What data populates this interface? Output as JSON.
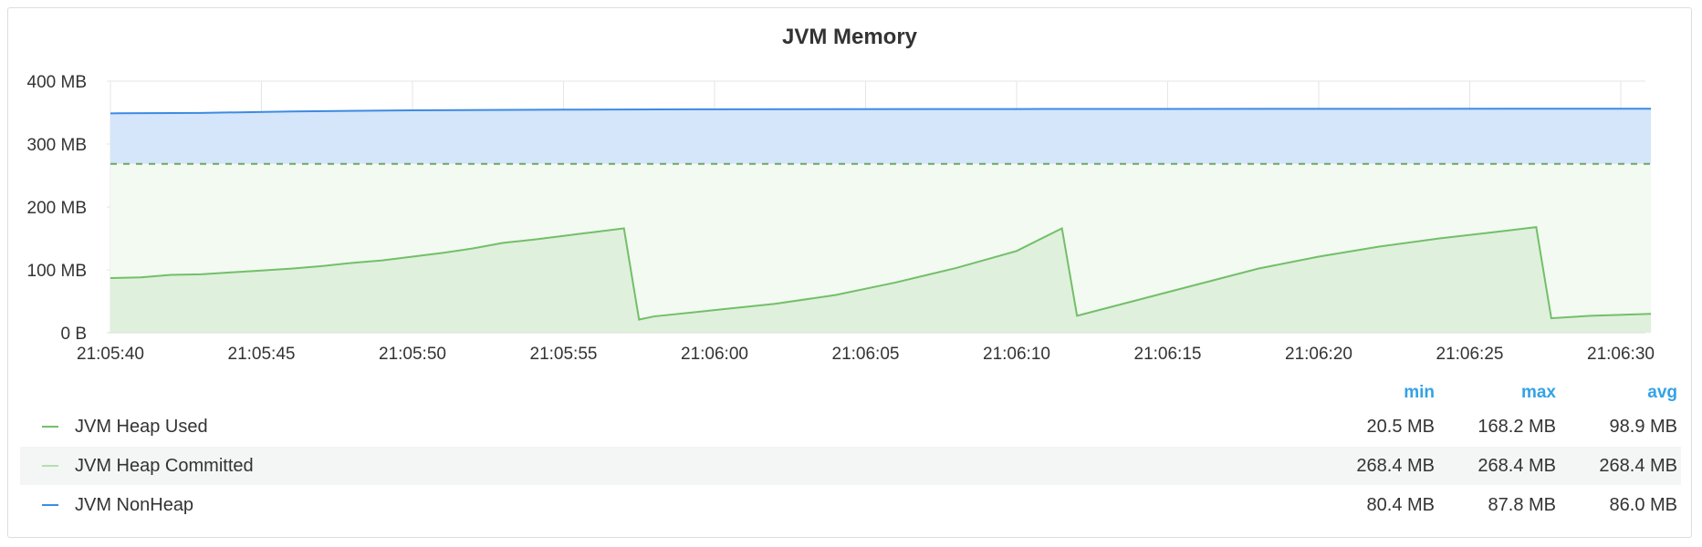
{
  "panel": {
    "title": "JVM Memory"
  },
  "legend": {
    "columns": {
      "min": "min",
      "max": "max",
      "avg": "avg"
    },
    "rows": [
      {
        "name": "JVM Heap Used",
        "color": "#73bf69",
        "min": "20.5 MB",
        "max": "168.2 MB",
        "avg": "98.9 MB"
      },
      {
        "name": "JVM Heap Committed",
        "color": "#b3e0ad",
        "min": "268.4 MB",
        "max": "268.4 MB",
        "avg": "268.4 MB"
      },
      {
        "name": "JVM NonHeap",
        "color": "#3d8be3",
        "min": "80.4 MB",
        "max": "87.8 MB",
        "avg": "86.0 MB"
      }
    ]
  },
  "chart_data": {
    "type": "area",
    "title": "JVM Memory",
    "y_unit": "MB",
    "ylim": [
      0,
      400
    ],
    "yticks": [
      0,
      100,
      200,
      300,
      400
    ],
    "ytick_labels": [
      "0 B",
      "100 MB",
      "200 MB",
      "300 MB",
      "400 MB"
    ],
    "xlim": [
      "21:05:40",
      "21:06:31"
    ],
    "xtick_labels": [
      "21:05:40",
      "21:05:45",
      "21:05:50",
      "21:05:55",
      "21:06:00",
      "21:06:05",
      "21:06:10",
      "21:06:15",
      "21:06:20",
      "21:06:25",
      "21:06:30"
    ],
    "grid": true,
    "legend_position": "bottom",
    "series": [
      {
        "name": "JVM Heap Used",
        "color": "#73bf69",
        "style": "solid-fill",
        "x": [
          "21:05:40",
          "21:05:41",
          "21:05:42",
          "21:05:43",
          "21:05:44",
          "21:05:45",
          "21:05:46",
          "21:05:47",
          "21:05:48",
          "21:05:49",
          "21:05:50",
          "21:05:51",
          "21:05:52",
          "21:05:53",
          "21:05:54",
          "21:05:55",
          "21:05:56",
          "21:05:57",
          "21:05:57.5",
          "21:05:58",
          "21:06:00",
          "21:06:02",
          "21:06:04",
          "21:06:06",
          "21:06:08",
          "21:06:10",
          "21:06:11.5",
          "21:06:12",
          "21:06:14",
          "21:06:16",
          "21:06:18",
          "21:06:20",
          "21:06:22",
          "21:06:24",
          "21:06:26",
          "21:06:27.2",
          "21:06:27.7",
          "21:06:29",
          "21:06:31"
        ],
        "values": [
          87,
          88,
          92,
          93,
          96,
          99,
          102,
          106,
          111,
          115,
          121,
          127,
          134,
          143,
          148,
          154,
          160,
          166,
          21,
          26,
          36,
          46,
          60,
          80,
          103,
          130,
          166,
          27,
          52,
          77,
          102,
          121,
          137,
          150,
          161,
          168,
          23,
          27,
          30
        ]
      },
      {
        "name": "JVM Heap Committed",
        "color": "#b3e0ad",
        "style": "dashed-fill",
        "x": [
          "21:05:40",
          "21:06:31"
        ],
        "values": [
          268.4,
          268.4
        ]
      },
      {
        "name": "JVM NonHeap",
        "color": "#3d8be3",
        "style": "stacked-fill",
        "x": [
          "21:05:40",
          "21:05:43",
          "21:05:46",
          "21:05:50",
          "21:05:55",
          "21:06:00",
          "21:06:10",
          "21:06:20",
          "21:06:31"
        ],
        "values": [
          80.4,
          81.0,
          83.5,
          85.2,
          86.3,
          86.9,
          87.3,
          87.6,
          87.8
        ]
      }
    ]
  }
}
